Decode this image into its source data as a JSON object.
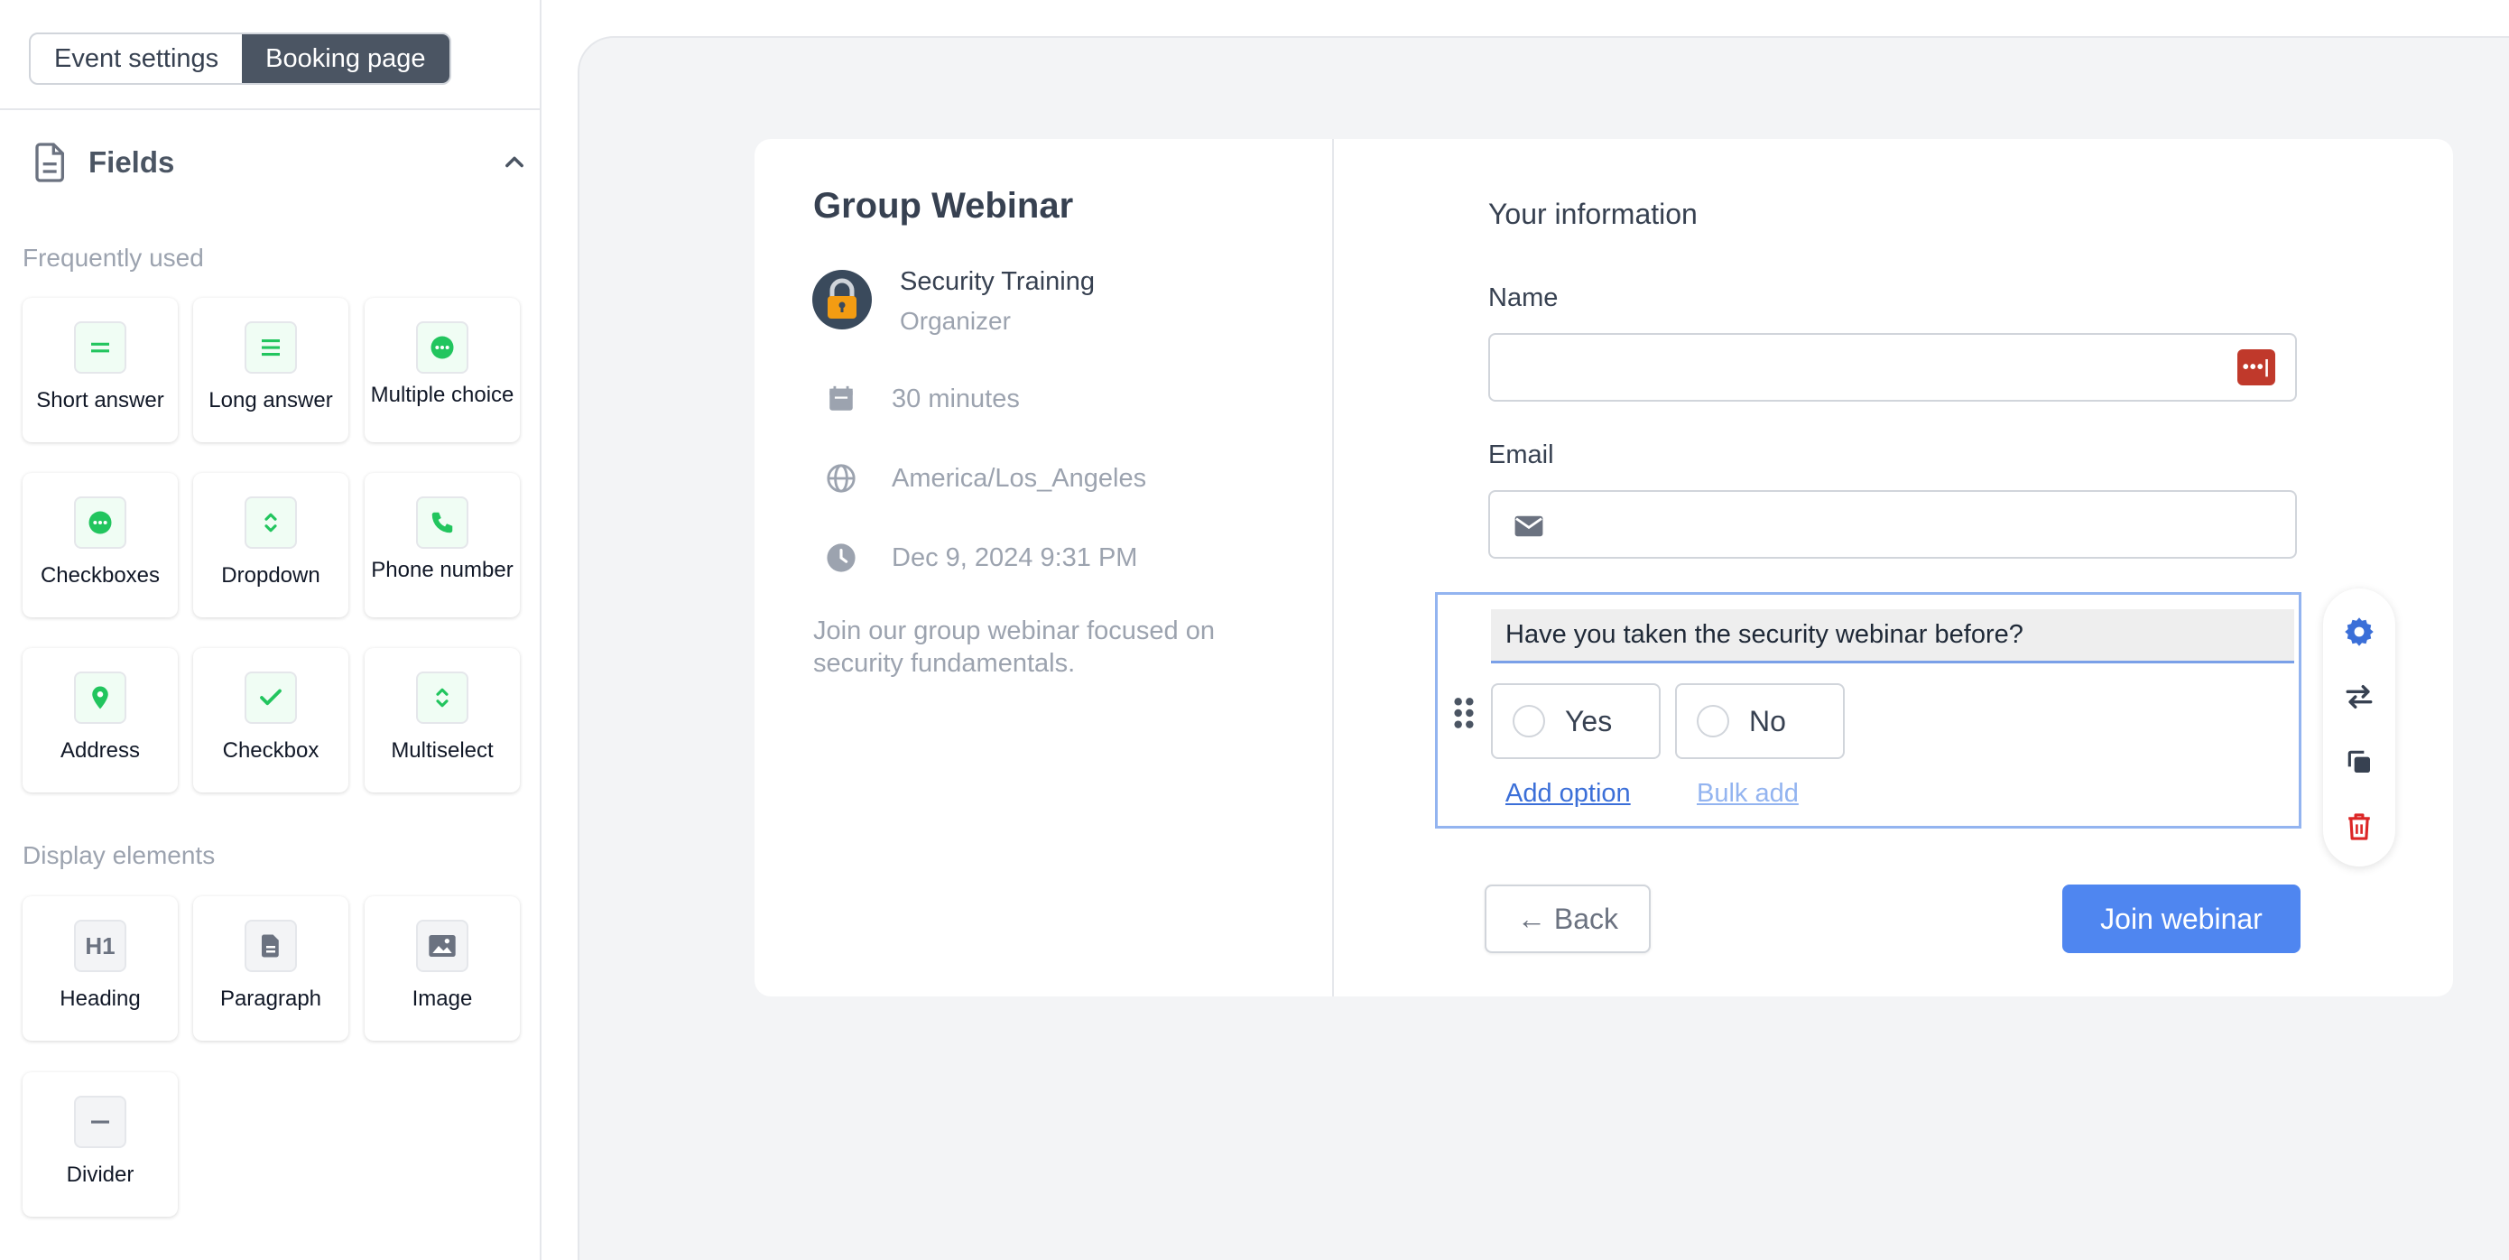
{
  "tabs": [
    "Event settings",
    "Booking page"
  ],
  "active_tab": "Booking page",
  "fields_panel": {
    "title": "Fields",
    "frequently_used_label": "Frequently used",
    "frequently_used": [
      {
        "label": "Short answer",
        "icon": "short-answer-icon"
      },
      {
        "label": "Long answer",
        "icon": "long-answer-icon"
      },
      {
        "label": "Multiple choice",
        "icon": "multiple-choice-icon"
      },
      {
        "label": "Checkboxes",
        "icon": "checkboxes-icon"
      },
      {
        "label": "Dropdown",
        "icon": "dropdown-icon"
      },
      {
        "label": "Phone number",
        "icon": "phone-icon"
      },
      {
        "label": "Address",
        "icon": "location-pin-icon"
      },
      {
        "label": "Checkbox",
        "icon": "checkmark-icon"
      },
      {
        "label": "Multiselect",
        "icon": "multiselect-icon"
      }
    ],
    "display_elements_label": "Display elements",
    "display_elements": [
      {
        "label": "Heading",
        "icon": "heading-icon"
      },
      {
        "label": "Paragraph",
        "icon": "paragraph-icon"
      },
      {
        "label": "Image",
        "icon": "image-icon"
      },
      {
        "label": "Divider",
        "icon": "divider-icon"
      }
    ]
  },
  "event": {
    "title": "Group Webinar",
    "organizer_name": "Security Training",
    "organizer_role": "Organizer",
    "duration": "30 minutes",
    "timezone": "America/Los_Angeles",
    "datetime": "Dec 9, 2024 9:31 PM",
    "description": "Join our group webinar focused on security fundamentals."
  },
  "form": {
    "section_title": "Your information",
    "name_label": "Name",
    "name_value": "",
    "password_manager_badge": "•••|",
    "email_label": "Email",
    "email_value": "",
    "question": "Have you taken the security webinar before?",
    "options": [
      "Yes",
      "No"
    ],
    "add_option_label": "Add option",
    "bulk_add_label": "Bulk add",
    "back_label": "← Back",
    "join_label": "Join webinar"
  },
  "colors": {
    "accent": "#4f86f0",
    "selection_border": "#93b4f0",
    "field_icon_green": "#22c55e",
    "delete_red": "#dc2626",
    "active_tab_bg": "#4b5563"
  }
}
